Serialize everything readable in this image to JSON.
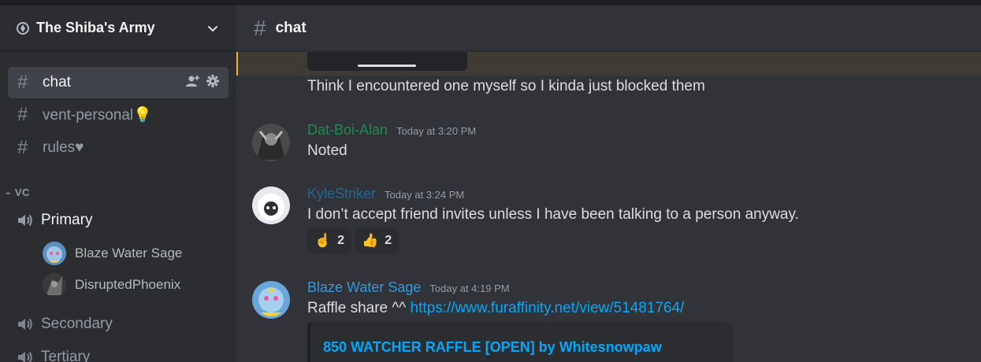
{
  "server": {
    "name": "The Shiba's Army"
  },
  "sidebar": {
    "channels": [
      {
        "label": "chat"
      },
      {
        "label": "vent-personal💡"
      },
      {
        "label": "rules♥"
      }
    ],
    "category": "VC",
    "voice_channels": [
      {
        "label": "Primary"
      },
      {
        "label": "Secondary"
      },
      {
        "label": "Tertiary"
      }
    ],
    "voice_users": [
      {
        "name": "Blaze Water Sage"
      },
      {
        "name": "DisruptedPhoenix"
      }
    ]
  },
  "channel_header": {
    "title": "chat"
  },
  "messages": [
    {
      "text": "Think I encountered one myself so I kinda just blocked them"
    },
    {
      "author": "Dat-Boi-Alan",
      "author_color": "#1f8b4c",
      "time": "Today at 3:20 PM",
      "text": "Noted"
    },
    {
      "author": "KyleStriker",
      "author_color": "#206694",
      "time": "Today at 3:24 PM",
      "text": "I don’t accept friend invites unless I have been talking to a person anyway.",
      "reactions": [
        {
          "emoji": "☝️",
          "count": "2"
        },
        {
          "emoji": "👍",
          "count": "2"
        }
      ]
    },
    {
      "author": "Blaze Water Sage",
      "author_color": "#3498db",
      "time": "Today at 4:19 PM",
      "text": "Raffle share ^^ ",
      "link": "https://www.furaffinity.net/view/51481764/",
      "embed_title": "850 WATCHER RAFFLE [OPEN] by Whitesnowpaw"
    }
  ],
  "colors": {
    "link": "#00a8fc",
    "highlight_accent": "#f0b232",
    "active_channel_bg": "#404249"
  },
  "icons": [
    "server-icon",
    "chevron-down-icon",
    "hash-icon",
    "add-member-icon",
    "gear-icon",
    "speaker-icon"
  ]
}
